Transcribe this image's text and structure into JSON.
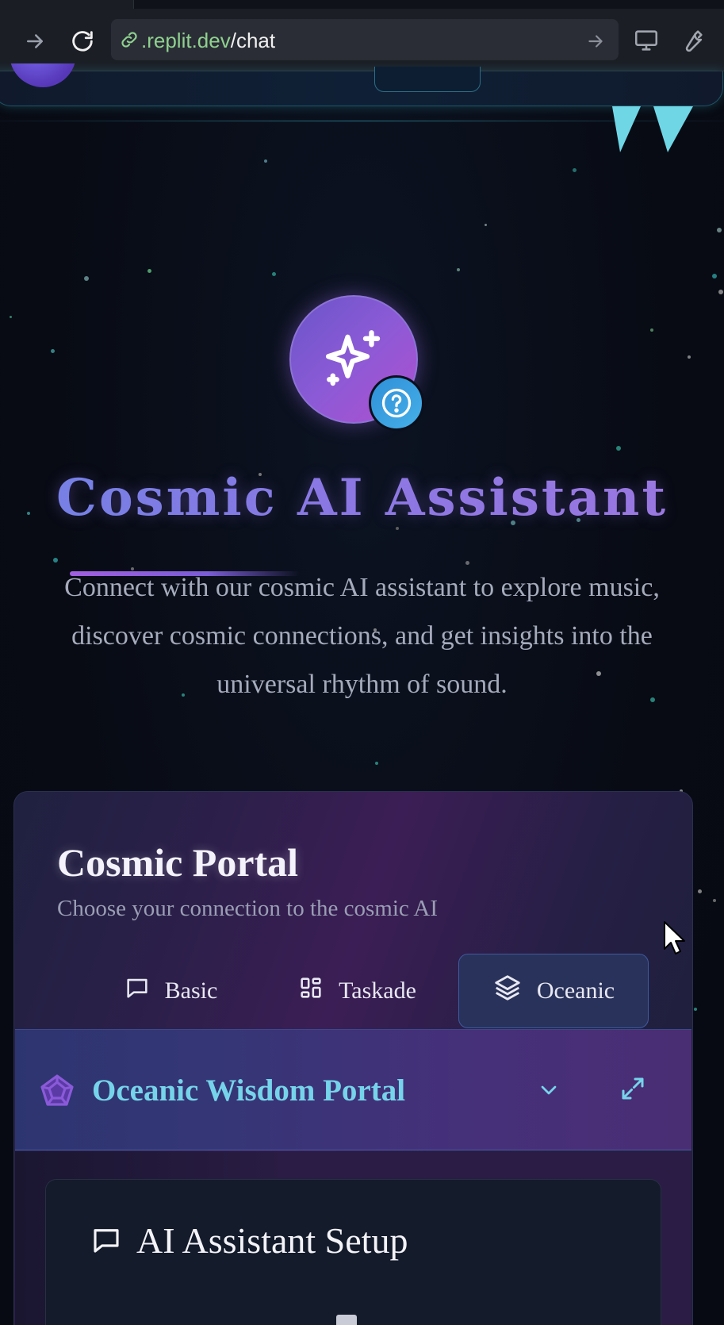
{
  "browser": {
    "url_domain": ".replit.dev",
    "url_path": "/chat"
  },
  "hero": {
    "title": "Cosmic AI Assistant",
    "subtitle_line1": "Connect with our cosmic AI assistant to explore music,",
    "subtitle_line2": "discover cosmic connections, and get insights into the",
    "subtitle_line3": "universal rhythm of sound."
  },
  "portal_card": {
    "title": "Cosmic Portal",
    "subtitle": "Choose your connection to the cosmic AI",
    "tabs": [
      {
        "label": "Basic",
        "icon": "message-square-icon",
        "active": false
      },
      {
        "label": "Taskade",
        "icon": "layout-grid-icon",
        "active": false
      },
      {
        "label": "Oceanic",
        "icon": "layers-icon",
        "active": true
      }
    ]
  },
  "oceanic_portal": {
    "title": "Oceanic Wisdom Portal",
    "icon": "pentagon-web-icon"
  },
  "setup": {
    "title": "AI Assistant Setup",
    "icon": "message-square-icon"
  },
  "colors": {
    "accent_cyan": "#76d4ea",
    "accent_purple": "#8b7ae4",
    "badge_blue": "#3aa0e0",
    "background": "#080b14"
  }
}
